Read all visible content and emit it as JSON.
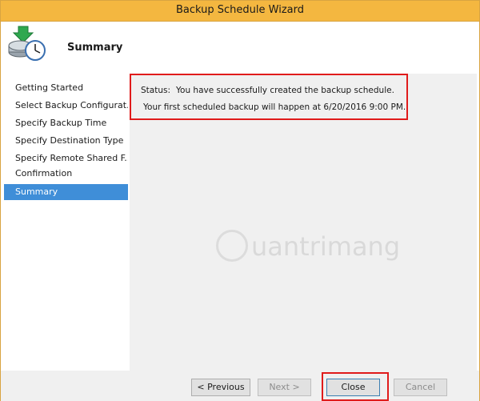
{
  "window": {
    "title": "Backup Schedule Wizard"
  },
  "header": {
    "title": "Summary",
    "icon": "backup-schedule-icon"
  },
  "sidebar": {
    "items": [
      {
        "label": "Getting Started",
        "active": false
      },
      {
        "label": "Select Backup Configurat...",
        "active": false
      },
      {
        "label": "Specify Backup Time",
        "active": false
      },
      {
        "label": "Specify Destination Type",
        "active": false
      },
      {
        "label": "Specify Remote Shared F...",
        "active": false
      },
      {
        "label": "Confirmation",
        "active": false
      },
      {
        "label": "Summary",
        "active": true
      }
    ]
  },
  "main": {
    "status_label": "Status:",
    "status_value": "You have successfully created the backup schedule.",
    "status_detail": "Your first scheduled backup will happen at 6/20/2016 9:00 PM.",
    "watermark": "uantrimang"
  },
  "footer": {
    "previous_label": "< Previous",
    "next_label": "Next >",
    "close_label": "Close",
    "cancel_label": "Cancel"
  },
  "colors": {
    "title_bar": "#f4b740",
    "selected_item": "#3f8ed8",
    "highlight": "#e01b1b"
  }
}
